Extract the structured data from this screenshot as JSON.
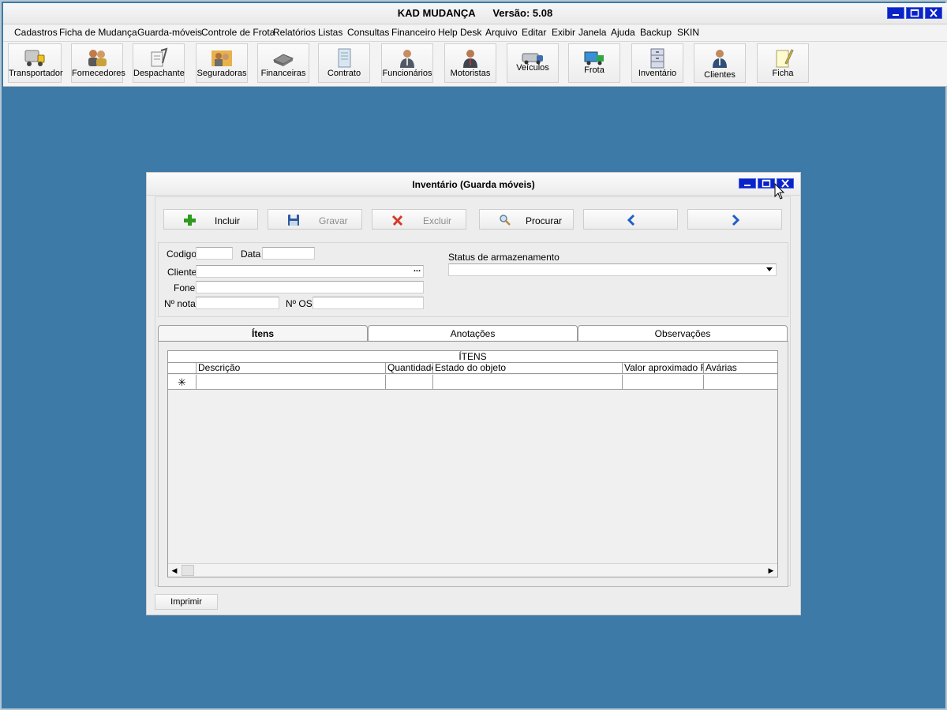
{
  "app": {
    "name": "KAD MUDANÇA",
    "version": "Versão: 5.08"
  },
  "menu": [
    "Cadastros",
    "Ficha de Mudança",
    "Guarda-móveis",
    "Controle de Frota",
    "Relatórios",
    "Listas",
    "Consultas",
    "Financeiro",
    "Help Desk",
    "Arquivo",
    "Editar",
    "Exibir",
    "Janela",
    "Ajuda",
    "Backup",
    "SKIN"
  ],
  "toolbar": [
    "Transportador",
    "Fornecedores",
    "Despachante",
    "Seguradoras",
    "Financeiras",
    "Contrato",
    "Funcionários",
    "Motoristas",
    "Veículos",
    "Frota",
    "Inventário",
    "Clientes",
    "Ficha"
  ],
  "dialog": {
    "title": "Inventário (Guarda móveis)",
    "actions": {
      "incluir": "Incluir",
      "gravar": "Gravar",
      "excluir": "Excluir",
      "procurar": "Procurar"
    },
    "fields": {
      "codigo_label": "Codigo",
      "data_label": "Data",
      "cliente_label": "Cliente",
      "cliente_lookup": "...",
      "fone_label": "Fone",
      "nota_label": "Nº nota",
      "os_label": "Nº OS",
      "status_label": "Status de armazenamento"
    },
    "tabs": [
      "Ítens",
      "Anotações",
      "Observações"
    ],
    "grid": {
      "caption": "ÍTENS",
      "columns": [
        "Descrição",
        "Quantidade",
        "Estado do objeto",
        "Valor aproximado R$",
        "Avárias"
      ],
      "new_row_marker": "✳"
    },
    "print_label": "Imprimir"
  },
  "colors": {
    "desktop": "#3d7aa8",
    "window_button": "#0a23c8",
    "green_plus": "#2f9a1f",
    "red_x": "#d33a2c",
    "nav_arrow": "#1f5fc4"
  },
  "icons": {
    "window": [
      "minimize-icon",
      "maximize-icon",
      "close-icon"
    ],
    "actions": [
      "plus-icon",
      "floppy-disk-icon",
      "delete-x-icon",
      "magnifier-icon",
      "arrow-left-icon",
      "arrow-right-icon"
    ]
  }
}
